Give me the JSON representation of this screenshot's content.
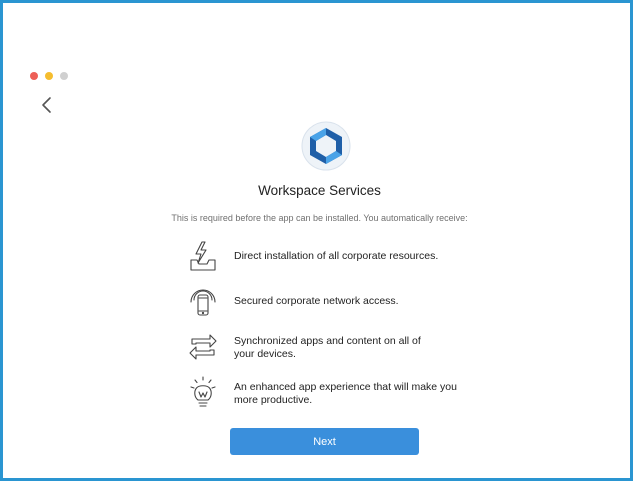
{
  "window": {
    "controls": [
      "close",
      "minimize",
      "zoom"
    ]
  },
  "nav": {
    "back_icon": "chevron-left-icon"
  },
  "header": {
    "logo_icon": "workspace-services-logo-icon",
    "title": "Workspace Services",
    "subtitle": "This is required before the app can be installed. You automatically receive:"
  },
  "features": [
    {
      "icon": "tray-lightning-icon",
      "text": "Direct installation of all corporate resources."
    },
    {
      "icon": "phone-signal-icon",
      "text": "Secured corporate network access."
    },
    {
      "icon": "sync-arrows-icon",
      "line1": "Synchronized apps and content on all of",
      "line2": "your devices."
    },
    {
      "icon": "lightbulb-icon",
      "line1": "An enhanced app experience that will make you",
      "line2": "more productive."
    }
  ],
  "actions": {
    "next_label": "Next"
  },
  "colors": {
    "border": "#2a95d1",
    "button": "#3a8fdc",
    "logo_dark": "#1f5fa8",
    "logo_light": "#4aa3e8"
  }
}
